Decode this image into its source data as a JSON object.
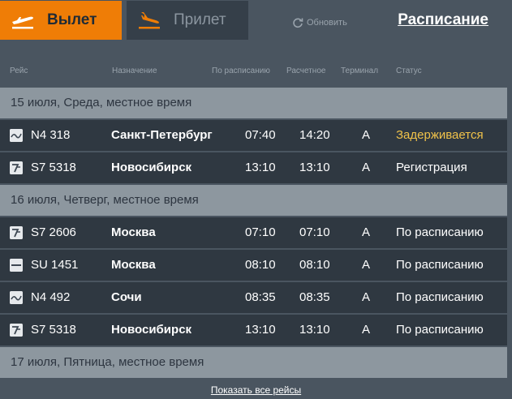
{
  "tabs": {
    "departure": "Вылет",
    "arrival": "Прилет"
  },
  "refresh_label": "Обновить",
  "schedule_label": "Расписание",
  "columns": {
    "flight": "Рейс",
    "destination": "Назначение",
    "scheduled": "По расписанию",
    "estimated": "Расчетное",
    "terminal": "Терминал",
    "status": "Статус"
  },
  "days": [
    {
      "label": "15 июля, Среда, местное время",
      "flights": [
        {
          "airline_icon": "nordwind-logo-icon",
          "flight": "N4 318",
          "destination": "Санкт-Петербург",
          "scheduled": "07:40",
          "estimated": "14:20",
          "terminal": "A",
          "status": "Задерживается",
          "status_color": "#f0c24a"
        },
        {
          "airline_icon": "s7-logo-icon",
          "flight": "S7 5318",
          "destination": "Новосибирск",
          "scheduled": "13:10",
          "estimated": "13:10",
          "terminal": "A",
          "status": "Регистрация",
          "status_color": "#ffffff"
        }
      ]
    },
    {
      "label": "16 июля, Четверг, местное время",
      "flights": [
        {
          "airline_icon": "s7-logo-icon",
          "flight": "S7 2606",
          "destination": "Москва",
          "scheduled": "07:10",
          "estimated": "07:10",
          "terminal": "A",
          "status": "По расписанию",
          "status_color": "#ffffff"
        },
        {
          "airline_icon": "aeroflot-logo-icon",
          "flight": "SU 1451",
          "destination": "Москва",
          "scheduled": "08:10",
          "estimated": "08:10",
          "terminal": "A",
          "status": "По расписанию",
          "status_color": "#ffffff"
        },
        {
          "airline_icon": "nordwind-logo-icon",
          "flight": "N4 492",
          "destination": "Сочи",
          "scheduled": "08:35",
          "estimated": "08:35",
          "terminal": "A",
          "status": "По расписанию",
          "status_color": "#ffffff"
        },
        {
          "airline_icon": "s7-logo-icon",
          "flight": "S7 5318",
          "destination": "Новосибирск",
          "scheduled": "13:10",
          "estimated": "13:10",
          "terminal": "A",
          "status": "По расписанию",
          "status_color": "#ffffff"
        }
      ]
    },
    {
      "label": "17 июля, Пятница, местное время",
      "flights": []
    }
  ],
  "show_all_label": "Показать все рейсы"
}
